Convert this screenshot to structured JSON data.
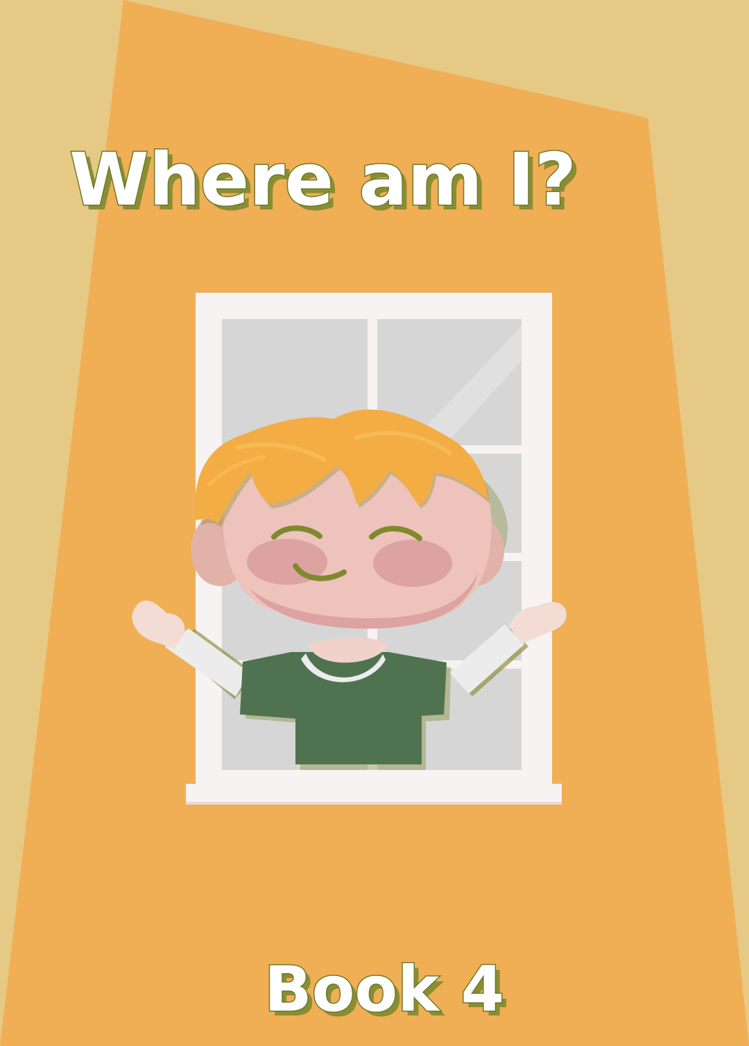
{
  "cover": {
    "title": "Where am I?",
    "subtitle": "Book 4"
  },
  "colors": {
    "background": "#e6c985",
    "wall": "#f0ae55",
    "window_frame": "#f7f3f2",
    "glass": "#d6d6d6",
    "skin": "#edc3bc",
    "cheeks": "#dca3a1",
    "hair": "#f3ad44",
    "shirt": "#4f7350",
    "sleeves": "#ececec",
    "text_shadow": "#7f8a2e"
  },
  "icons": [
    "window-illustration",
    "boy-illustration"
  ]
}
